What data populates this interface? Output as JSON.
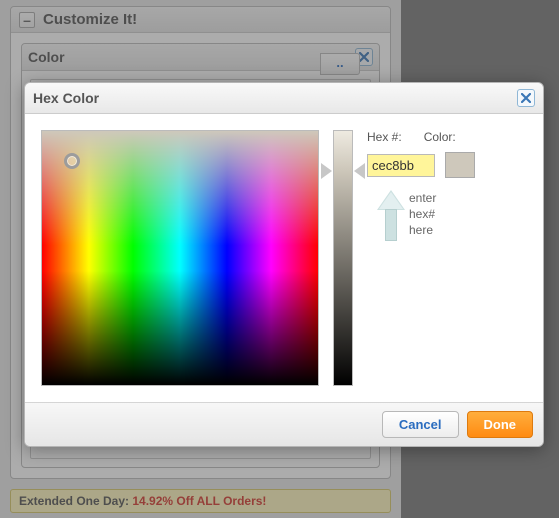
{
  "bg": {
    "panel_title": "Customize It!",
    "toggle_glyph": "–",
    "sub_title": "Color",
    "dots": "..",
    "promo_prefix": "Extended One Day: ",
    "promo_red": "14.92% Off ALL Orders!"
  },
  "dialog": {
    "title": "Hex Color",
    "hex_label": "Hex #:",
    "color_label": "Color:",
    "hex_value": "cec8bb",
    "swatch_hex": "#cec8bb",
    "hint_l1": "enter",
    "hint_l2": "hex#",
    "hint_l3": "here",
    "cancel": "Cancel",
    "done": "Done"
  }
}
